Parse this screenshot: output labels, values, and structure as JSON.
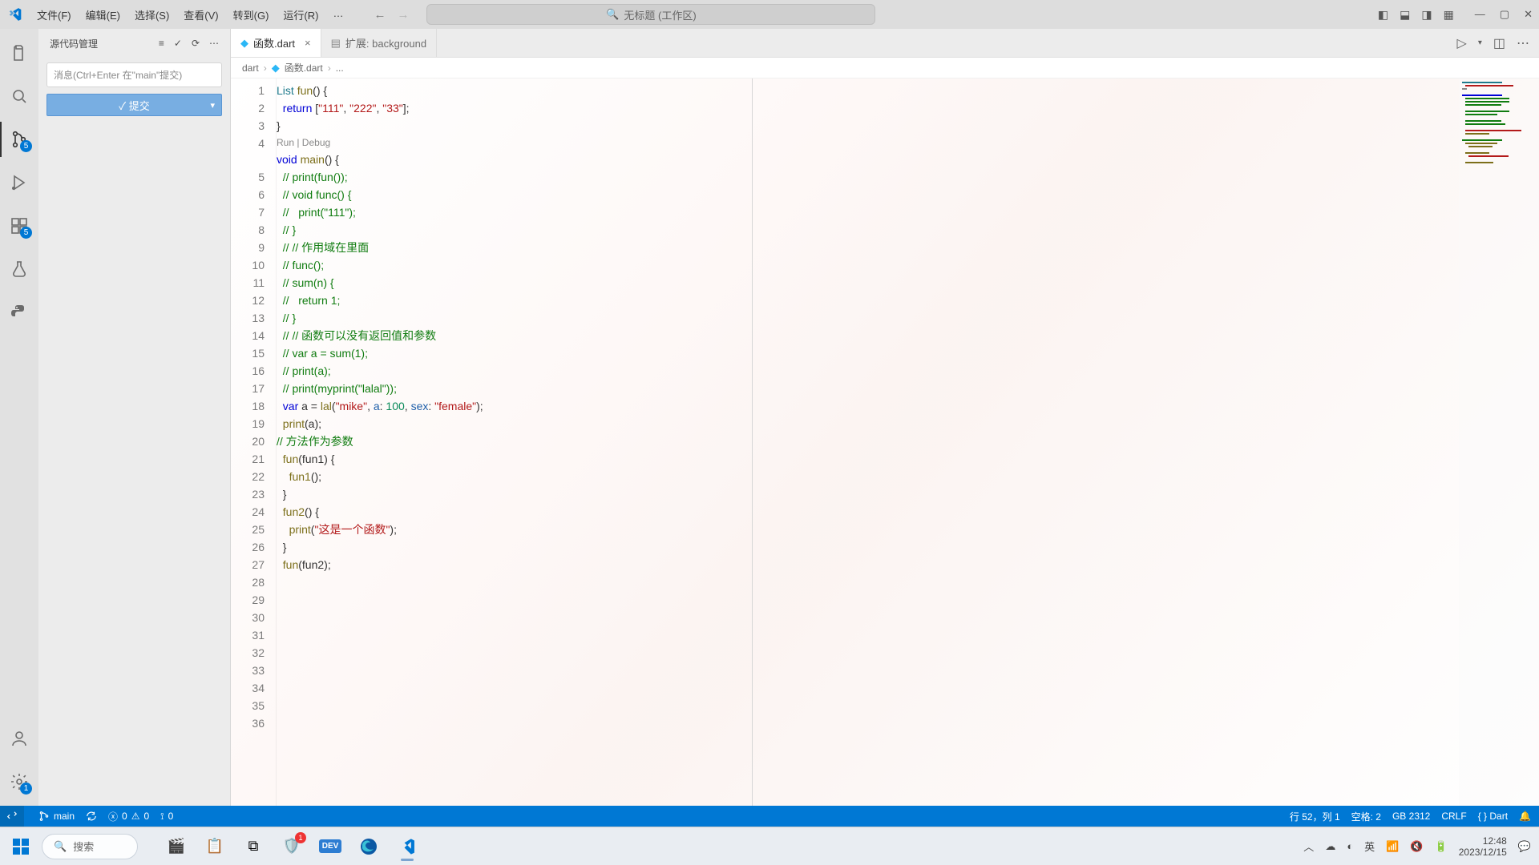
{
  "titlebar": {
    "menus": [
      "文件(F)",
      "编辑(E)",
      "选择(S)",
      "查看(V)",
      "转到(G)",
      "运行(R)",
      "…"
    ],
    "search_placeholder": "无标题 (工作区)"
  },
  "activitybar": {
    "scm_badge": "5",
    "extensions_badge": "5",
    "settings_badge": "1"
  },
  "sidebar": {
    "title": "源代码管理",
    "commit_placeholder": "消息(Ctrl+Enter 在\"main\"提交)",
    "commit_button": "✓ 提交"
  },
  "tabs": {
    "active": {
      "label": "函数.dart"
    },
    "inactive": {
      "label": "扩展: background"
    }
  },
  "breadcrumbs": {
    "seg1": "dart",
    "seg2": "函数.dart",
    "seg3": "..."
  },
  "codelens": "Run | Debug",
  "code_lines": [
    {
      "n": 1,
      "html": "<span class='tok-type'>List</span> <span class='tok-fn'>fun</span>() {"
    },
    {
      "n": 2,
      "html": "  <span class='tok-kw'>return</span> [<span class='tok-str'>\"111\"</span>, <span class='tok-str'>\"222\"</span>, <span class='tok-str'>\"33\"</span>];"
    },
    {
      "n": 3,
      "html": "}"
    },
    {
      "n": 4,
      "html": ""
    },
    {
      "n": 5,
      "html": "<span class='tok-kw'>void</span> <span class='tok-fn'>main</span>() {",
      "codelens": true
    },
    {
      "n": 6,
      "html": "  <span class='tok-com'>// print(fun());</span>"
    },
    {
      "n": 7,
      "html": ""
    },
    {
      "n": 8,
      "html": "  <span class='tok-com'>// void func() {</span>"
    },
    {
      "n": 9,
      "html": "  <span class='tok-com'>//   print(\"111\");</span>"
    },
    {
      "n": 10,
      "html": "  <span class='tok-com'>// }</span>"
    },
    {
      "n": 11,
      "html": ""
    },
    {
      "n": 12,
      "html": "  <span class='tok-com'>// // 作用域在里面</span>"
    },
    {
      "n": 13,
      "html": "  <span class='tok-com'>// func();</span>"
    },
    {
      "n": 14,
      "html": ""
    },
    {
      "n": 15,
      "html": "  <span class='tok-com'>// sum(n) {</span>"
    },
    {
      "n": 16,
      "html": "  <span class='tok-com'>//   return 1;</span>"
    },
    {
      "n": 17,
      "html": "  <span class='tok-com'>// }</span>"
    },
    {
      "n": 18,
      "html": ""
    },
    {
      "n": 19,
      "html": "  <span class='tok-com'>// // 函数可以没有返回值和参数</span>"
    },
    {
      "n": 20,
      "html": "  <span class='tok-com'>// var a = sum(1);</span>"
    },
    {
      "n": 21,
      "html": "  <span class='tok-com'>// print(a);</span>"
    },
    {
      "n": 22,
      "html": "  <span class='tok-com'>// print(myprint(\"lalal\"));</span>"
    },
    {
      "n": 23,
      "html": "  <span class='tok-kw'>var</span> a = <span class='tok-fn'>lal</span>(<span class='tok-str'>\"mike\"</span>, <span class='tok-nm'>a</span>: <span class='tok-num'>100</span>, <span class='tok-nm'>sex</span>: <span class='tok-str'>\"female\"</span>);"
    },
    {
      "n": 24,
      "html": "  <span class='tok-fn'>print</span>(a);"
    },
    {
      "n": 25,
      "html": ""
    },
    {
      "n": 26,
      "html": "<span class='tok-com'>// 方法作为参数</span>"
    },
    {
      "n": 27,
      "html": "  <span class='tok-fn'>fun</span>(fun1) {"
    },
    {
      "n": 28,
      "html": "    <span class='tok-fn'>fun1</span>();"
    },
    {
      "n": 29,
      "html": "  }"
    },
    {
      "n": 30,
      "html": ""
    },
    {
      "n": 31,
      "html": "  <span class='tok-fn'>fun2</span>() {"
    },
    {
      "n": 32,
      "html": "    <span class='tok-fn'>print</span>(<span class='tok-str'>\"这是一个函数\"</span>);"
    },
    {
      "n": 33,
      "html": "  }"
    },
    {
      "n": 34,
      "html": ""
    },
    {
      "n": 35,
      "html": "  <span class='tok-fn'>fun</span>(fun2);"
    },
    {
      "n": 36,
      "html": ""
    }
  ],
  "statusbar": {
    "branch": "main",
    "errors": "0",
    "warnings": "0",
    "ports": "0",
    "cursor": "行 52，列 1",
    "spaces": "空格: 2",
    "encoding": "GB 2312",
    "eol": "CRLF",
    "lang": "{ } Dart"
  },
  "taskbar": {
    "search": "搜索",
    "time": "12:48",
    "date": "2023/12/15",
    "ime": "英"
  }
}
